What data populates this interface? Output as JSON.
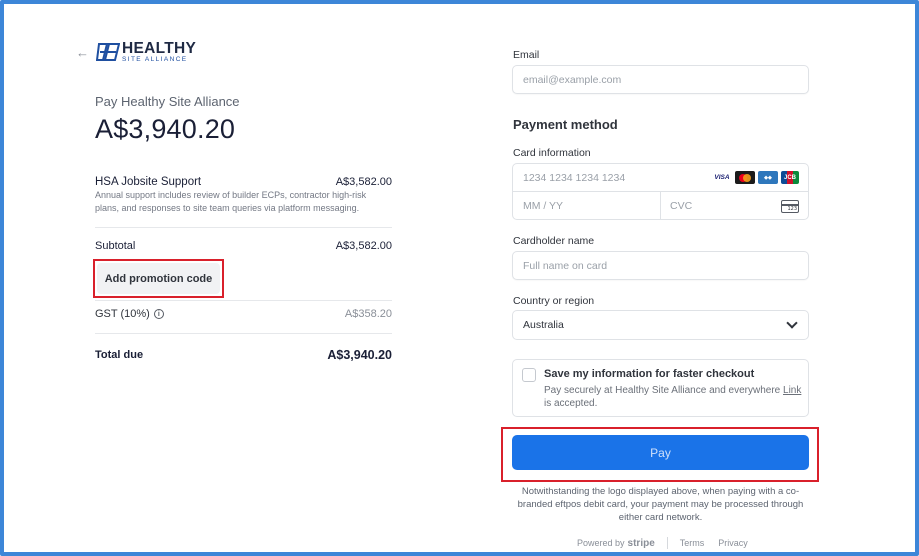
{
  "left": {
    "back_icon": "arrow-left-icon",
    "logo_main": "HEALTHY",
    "logo_sub": "SITE ALLIANCE",
    "pay_to": "Pay Healthy Site Alliance",
    "amount": "A$3,940.20",
    "item": {
      "name": "HSA Jobsite Support",
      "price": "A$3,582.00",
      "description": "Annual support includes review of builder ECPs, contractor high-risk plans, and responses to site team queries via platform messaging."
    },
    "subtotal_label": "Subtotal",
    "subtotal_value": "A$3,582.00",
    "promo_label": "Add promotion code",
    "gst_label": "GST (10%)",
    "gst_value": "A$358.20",
    "total_label": "Total due",
    "total_value": "A$3,940.20"
  },
  "right": {
    "email_label": "Email",
    "email_placeholder": "email@example.com",
    "payment_method_title": "Payment method",
    "card_info_label": "Card information",
    "card_number_placeholder": "1234 1234 1234 1234",
    "card_brands": [
      "VISA",
      "mastercard",
      "amex",
      "JCB"
    ],
    "expiry_placeholder": "MM / YY",
    "cvc_placeholder": "CVC",
    "cvc_icon_text": "123",
    "cardholder_label": "Cardholder name",
    "cardholder_placeholder": "Full name on card",
    "country_label": "Country or region",
    "country_value": "Australia",
    "save_title": "Save my information for faster checkout",
    "save_desc_prefix": "Pay securely at Healthy Site Alliance and everywhere ",
    "save_desc_link": "Link",
    "save_desc_suffix": " is accepted.",
    "pay_label": "Pay",
    "notice": "Notwithstanding the logo displayed above, when paying with a co-branded eftpos debit card, your payment may be processed through either card network.",
    "footer": {
      "powered_by": "Powered by",
      "stripe": "stripe",
      "terms": "Terms",
      "privacy": "Privacy"
    }
  },
  "colors": {
    "frame": "#3d86d8",
    "highlight": "#d9202b",
    "pay_button": "#1a73e8"
  }
}
